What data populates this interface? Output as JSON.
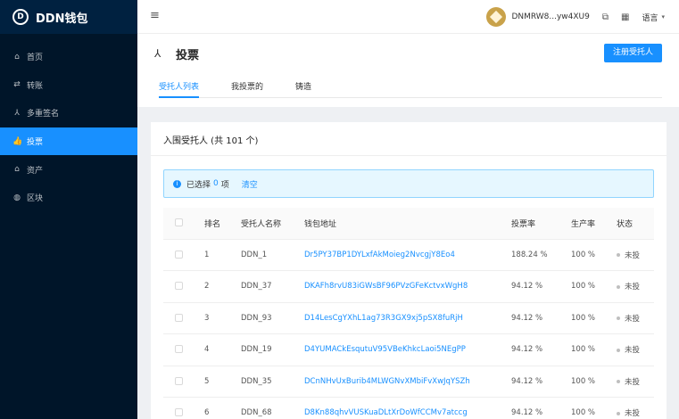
{
  "brand": {
    "logo_letter": "D",
    "name": "DDN钱包"
  },
  "sidebar": {
    "items": [
      {
        "icon": "home-icon",
        "glyph": "⌂",
        "label": "首页",
        "active": false
      },
      {
        "icon": "transfer-icon",
        "glyph": "⇄",
        "label": "转账",
        "active": false
      },
      {
        "icon": "multisig-icon",
        "glyph": "⅄",
        "label": "多重签名",
        "active": false
      },
      {
        "icon": "thumbs-up-icon",
        "glyph": "👍",
        "label": "投票",
        "active": true
      },
      {
        "icon": "bank-icon",
        "glyph": "⌂",
        "label": "资产",
        "active": false
      },
      {
        "icon": "globe-icon",
        "glyph": "◍",
        "label": "区块",
        "active": false
      }
    ]
  },
  "header": {
    "fold_icon": "≡",
    "account": "DNMRW8...yw4XU9",
    "copy_icon": "⧉",
    "qr_icon": "▦",
    "language": "语言",
    "language_caret": "▾"
  },
  "page": {
    "icon": "⅄",
    "title": "投票",
    "register_button": "注册受托人",
    "tabs": [
      {
        "label": "受托人列表",
        "active": true
      },
      {
        "label": "我投票的",
        "active": false
      },
      {
        "label": "铸造",
        "active": false
      }
    ]
  },
  "card": {
    "title": "入围受托人 (共 101 个)",
    "alert": {
      "prefix": "已选择",
      "count": "0",
      "suffix": "项",
      "clear": "清空"
    },
    "columns": [
      "排名",
      "受托人名称",
      "钱包地址",
      "投票率",
      "生产率",
      "状态"
    ],
    "rows": [
      {
        "rank": "1",
        "name": "DDN_1",
        "address": "Dr5PY37BP1DYLxfAkMoieg2NvcgjY8Eo4",
        "vote_rate": "188.24 %",
        "prod_rate": "100 %",
        "status": "未投"
      },
      {
        "rank": "2",
        "name": "DDN_37",
        "address": "DKAFh8rvU83iGWsBF96PVzGFeKctvxWgH8",
        "vote_rate": "94.12 %",
        "prod_rate": "100 %",
        "status": "未投"
      },
      {
        "rank": "3",
        "name": "DDN_93",
        "address": "D14LesCgYXhL1ag73R3GX9xj5pSX8fuRjH",
        "vote_rate": "94.12 %",
        "prod_rate": "100 %",
        "status": "未投"
      },
      {
        "rank": "4",
        "name": "DDN_19",
        "address": "D4YUMACkEsqutuV95VBeKhkcLaoi5NEgPP",
        "vote_rate": "94.12 %",
        "prod_rate": "100 %",
        "status": "未投"
      },
      {
        "rank": "5",
        "name": "DDN_35",
        "address": "DCnNHvUxBurib4MLWGNvXMbiFvXwJqYSZh",
        "vote_rate": "94.12 %",
        "prod_rate": "100 %",
        "status": "未投"
      },
      {
        "rank": "6",
        "name": "DDN_68",
        "address": "D8Kn88qhvVUSKuaDLtXrDoWfCCMv7atccg",
        "vote_rate": "94.12 %",
        "prod_rate": "100 %",
        "status": "未投"
      }
    ]
  },
  "colors": {
    "primary": "#1890ff",
    "sidebar_bg": "#001529"
  }
}
